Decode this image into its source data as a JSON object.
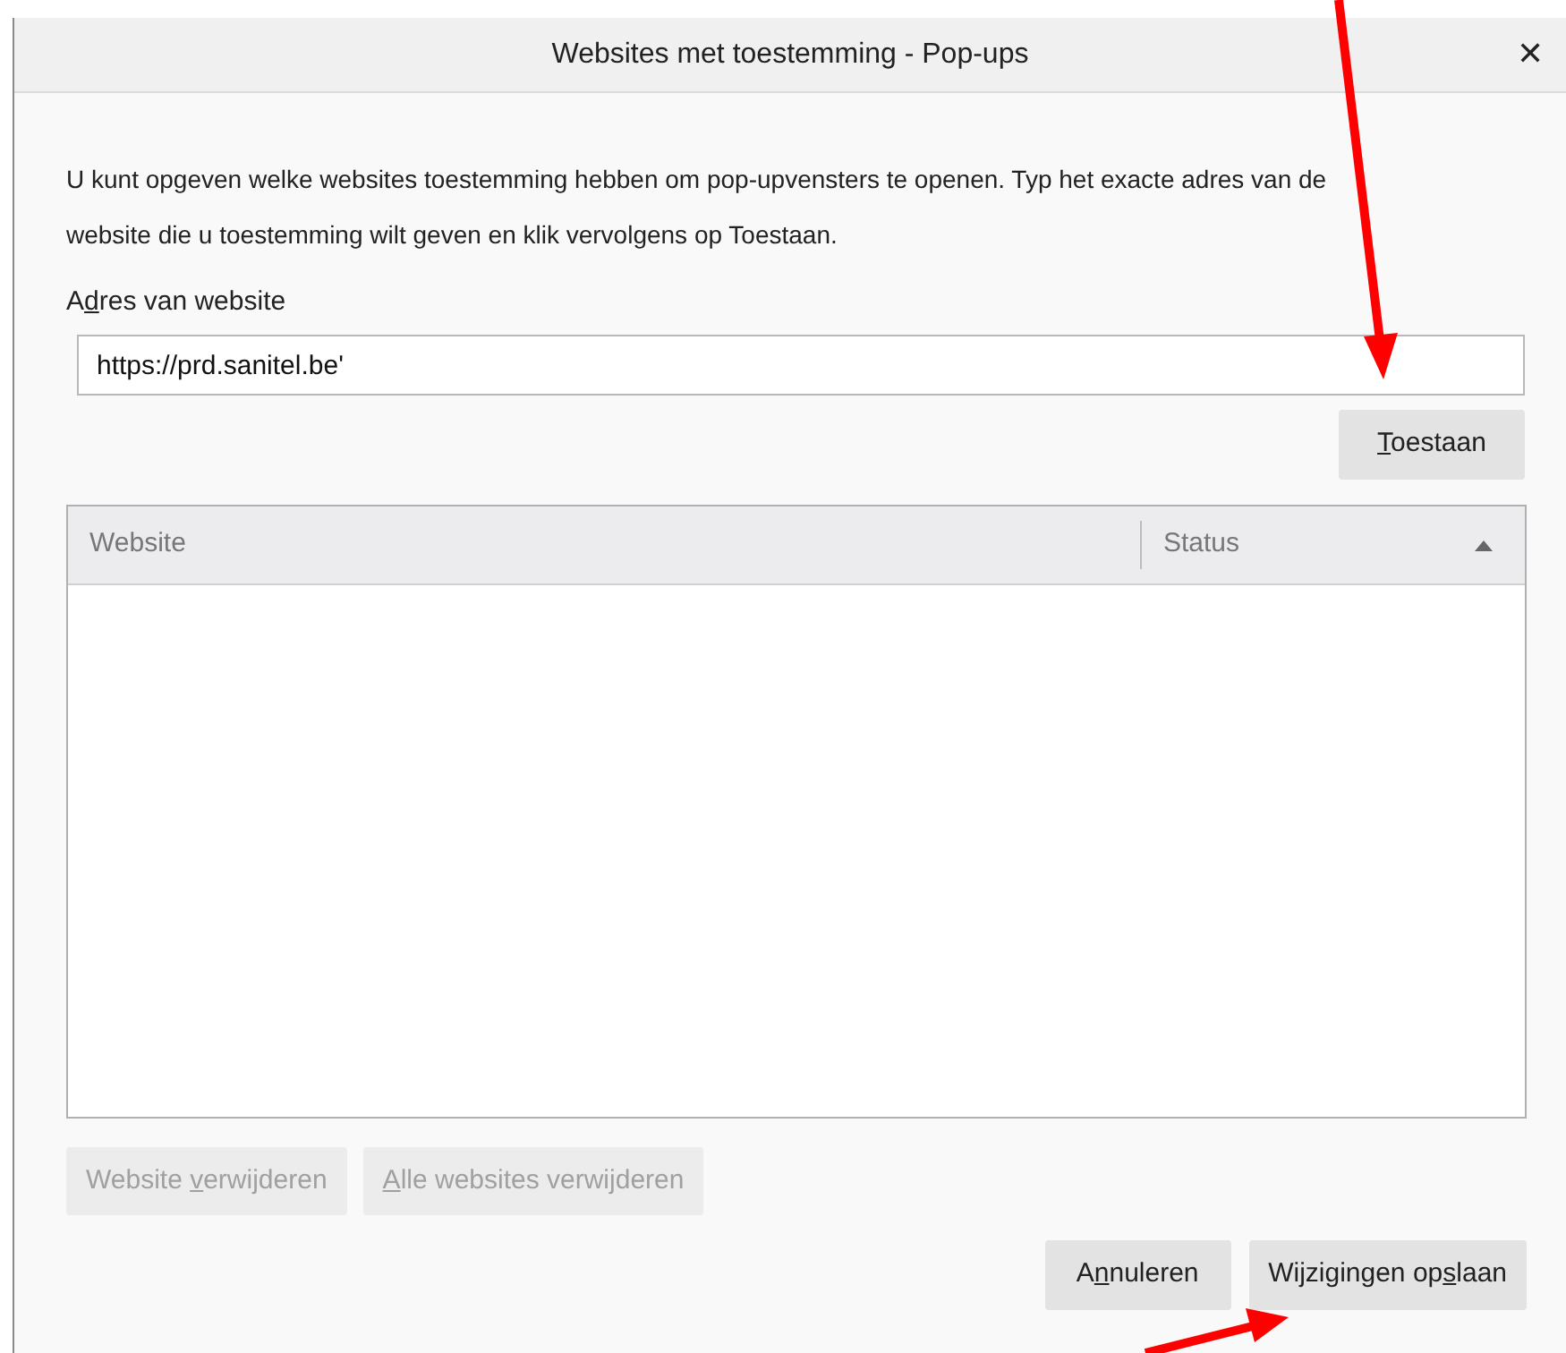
{
  "window": {
    "title": "Websites met toestemming - Pop-ups",
    "close": "✕"
  },
  "description": "U kunt opgeven welke websites toestemming hebben om pop-upvensters te openen. Typ het exacte adres van de website die u toestemming wilt geven en klik vervolgens op Toestaan.",
  "address": {
    "label": [
      {
        "text": "A",
        "underlined": false
      },
      {
        "text": "d",
        "underlined": true
      },
      {
        "text": "res van website",
        "underlined": false
      }
    ],
    "value": "https://prd.sanitel.be'"
  },
  "allow_button": {
    "label": [
      {
        "text": "T",
        "underlined": true
      },
      {
        "text": "oestaan",
        "underlined": false
      }
    ],
    "disabled": false
  },
  "table": {
    "columns": [
      {
        "label": "Website",
        "sorted": false
      },
      {
        "label": "Status",
        "sorted": true
      }
    ]
  },
  "list_buttons": [
    {
      "label": [
        {
          "text": "Website ",
          "underlined": false
        },
        {
          "text": "v",
          "underlined": true
        },
        {
          "text": "erwijderen",
          "underlined": false
        }
      ],
      "disabled": true
    },
    {
      "label": [
        {
          "text": "A",
          "underlined": true
        },
        {
          "text": "lle websites verwijderen",
          "underlined": false
        }
      ],
      "disabled": true
    }
  ],
  "footer_buttons": [
    {
      "label": [
        {
          "text": "A",
          "underlined": false
        },
        {
          "text": "n",
          "underlined": true
        },
        {
          "text": "nuleren",
          "underlined": false
        }
      ],
      "disabled": false
    },
    {
      "label": [
        {
          "text": "Wijzigingen op",
          "underlined": false
        },
        {
          "text": "s",
          "underlined": true
        },
        {
          "text": "laan",
          "underlined": false
        }
      ],
      "disabled": false
    }
  ]
}
